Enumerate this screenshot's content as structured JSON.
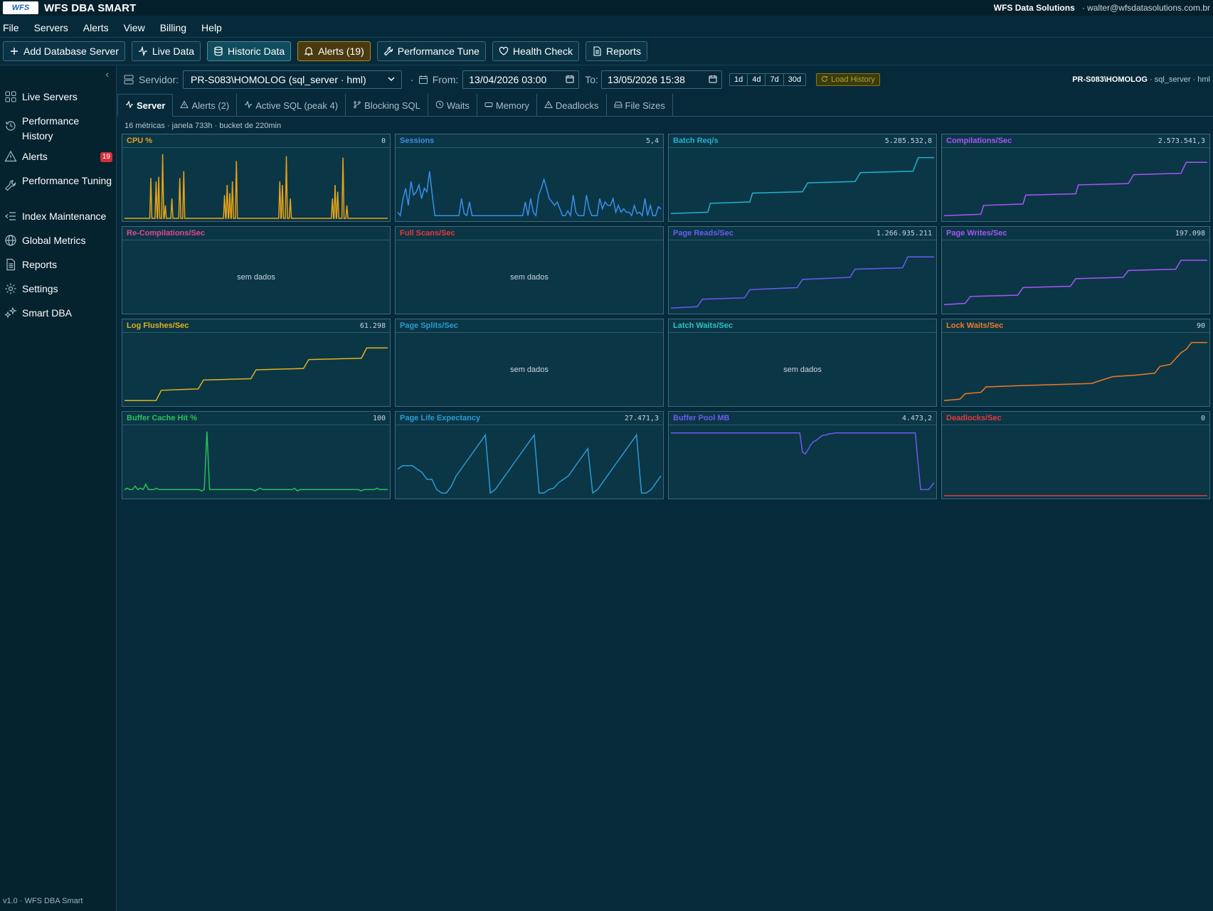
{
  "app": {
    "title": "WFS DBA SMART",
    "logo_text": "WFS",
    "company": "WFS Data Solutions",
    "user": "· walter@wfsdatasolutions.com.br"
  },
  "menu": [
    "File",
    "Servers",
    "Alerts",
    "View",
    "Billing",
    "Help"
  ],
  "toolbar": {
    "add_server": "Add Database Server",
    "live_data": "Live Data",
    "historic_data": "Historic Data",
    "alerts": "Alerts (19)",
    "performance_tune": "Performance Tune",
    "health_check": "Health Check",
    "reports": "Reports"
  },
  "sidebar": {
    "items": [
      {
        "label": "Live Servers",
        "icon": "grid-icon"
      },
      {
        "label": "Performance History",
        "icon": "history-icon"
      },
      {
        "label": "Alerts",
        "icon": "alert-triangle-icon",
        "badge": "19"
      },
      {
        "label": "Performance Tuning",
        "icon": "wrench-icon"
      },
      {
        "label": "Index Maintenance",
        "icon": "list-indent-icon"
      },
      {
        "label": "Global Metrics",
        "icon": "globe-icon"
      },
      {
        "label": "Reports",
        "icon": "document-icon"
      },
      {
        "label": "Settings",
        "icon": "gear-icon"
      },
      {
        "label": "Smart DBA",
        "icon": "sparkles-icon"
      }
    ],
    "version": "v1.0 · WFS DBA Smart"
  },
  "filter": {
    "server_label": "Servidor:",
    "server_value": "PR-S083\\HOMOLOG (sql_server · hml)",
    "dot": "·",
    "from_label": "From:",
    "from_value": "13/04/2026 03:00",
    "to_label": "To:",
    "to_value": "13/05/2026 15:38",
    "ranges": [
      "1d",
      "4d",
      "7d",
      "30d"
    ],
    "load_history": "Load History",
    "server_info_name": "PR-S083\\HOMOLOG",
    "server_info_meta": " · sql_server · hml"
  },
  "tabs": [
    "Server",
    "Alerts (2)",
    "Active SQL (peak 4)",
    "Blocking SQL",
    "Waits",
    "Memory",
    "Deadlocks",
    "File Sizes"
  ],
  "subinfo": "16 métricas · janela 733h · bucket de 220min",
  "nodata_text": "sem dados",
  "colors": {
    "orange": "#e8a317",
    "blue": "#3b8fe8",
    "cyan": "#1fb3d1",
    "purple": "#a855f7",
    "pink": "#e0488c",
    "red": "#e8383a",
    "violet": "#6a5cf0",
    "yellow": "#e2b21b",
    "sky": "#2a9bd4",
    "teal": "#2bc4c4",
    "deeporange": "#f07a25",
    "green": "#27c25a"
  },
  "metrics": [
    {
      "title": "CPU %",
      "value": "0",
      "color": "#e8a317",
      "nodata": false,
      "series": [
        0,
        0,
        0,
        0,
        0,
        0,
        0,
        0,
        0,
        0,
        0,
        0,
        0,
        0,
        0,
        0,
        0,
        0,
        0,
        0,
        0,
        0,
        0,
        0,
        0,
        0,
        0,
        0,
        0,
        0,
        0,
        0,
        0,
        0,
        0,
        0,
        0,
        0,
        0,
        0,
        0,
        0,
        0,
        0,
        0,
        0,
        0,
        0,
        0,
        0,
        0,
        0,
        0,
        0,
        0,
        0,
        0,
        0,
        0,
        0,
        0,
        0,
        0,
        0,
        0,
        0,
        0,
        0,
        0,
        0,
        0,
        0,
        0,
        0,
        0,
        0,
        0,
        0,
        0,
        0,
        0,
        0,
        0,
        0,
        0,
        0,
        0,
        0,
        0,
        0,
        0,
        0,
        0,
        0,
        0,
        0,
        0,
        0,
        0,
        0,
        0,
        0,
        0,
        0,
        0,
        0,
        0,
        0,
        0,
        0,
        0,
        0,
        0,
        0,
        0,
        0,
        0,
        0,
        0,
        0,
        0,
        0,
        0,
        0,
        0,
        0,
        0,
        0,
        0,
        0,
        0,
        0,
        0,
        0,
        0,
        0,
        0,
        0,
        0,
        0,
        0,
        0,
        0,
        0,
        0,
        0,
        0,
        0,
        0,
        0,
        0,
        0,
        0,
        0,
        0,
        0,
        0,
        0,
        0,
        0,
        0,
        0,
        0,
        0,
        0,
        0,
        0,
        0,
        0,
        0,
        0,
        0,
        0,
        0,
        0,
        0,
        0,
        0,
        0,
        0,
        0,
        0,
        0,
        0,
        0,
        0,
        0,
        0,
        0,
        0,
        0,
        0,
        0,
        0,
        0,
        0,
        0,
        0,
        0,
        0,
        0,
        0,
        0,
        0,
        0,
        0,
        0,
        0,
        0,
        0,
        0,
        0,
        0,
        0,
        0,
        0,
        0,
        0,
        0,
        0,
        0,
        0,
        0,
        0,
        0,
        0,
        0,
        0,
        0,
        0,
        0,
        0,
        0,
        0,
        0,
        0,
        0,
        0,
        0,
        0,
        0,
        0,
        0,
        0,
        0,
        0,
        0,
        0,
        0,
        0,
        0,
        0,
        0,
        0,
        0,
        0,
        0,
        0,
        0,
        0,
        0,
        0,
        0,
        0,
        0,
        0,
        0,
        0,
        0,
        0,
        0,
        0,
        0,
        0,
        0,
        0,
        0,
        0,
        0,
        0,
        0,
        0,
        0,
        0,
        0,
        0,
        0,
        0,
        0,
        0,
        0,
        0,
        0,
        0,
        0,
        0,
        0,
        0,
        0,
        0,
        0,
        0,
        0,
        0,
        0,
        0,
        0,
        0,
        0,
        0,
        0,
        0,
        0,
        0,
        0,
        0,
        0,
        0,
        0,
        0,
        0,
        0,
        0,
        0,
        0,
        0,
        0,
        0,
        0,
        0,
        0,
        0,
        0,
        0,
        0,
        0,
        0,
        0,
        0,
        0,
        0,
        0,
        0,
        0,
        0,
        0,
        0,
        0,
        0,
        0,
        0,
        0,
        0,
        0,
        0,
        0,
        0,
        0,
        0,
        0,
        0,
        0,
        0,
        0,
        0,
        0,
        0,
        0,
        0,
        0,
        0,
        0,
        0,
        0,
        0,
        0,
        0,
        0,
        0,
        0
      ],
      "spikes": [
        [
          0.1,
          0.6
        ],
        [
          0.12,
          0.55
        ],
        [
          0.13,
          0.62
        ],
        [
          0.145,
          0.95
        ],
        [
          0.155,
          0.2
        ],
        [
          0.18,
          0.3
        ],
        [
          0.21,
          0.6
        ],
        [
          0.225,
          0.7
        ],
        [
          0.38,
          0.35
        ],
        [
          0.39,
          0.5
        ],
        [
          0.4,
          0.38
        ],
        [
          0.41,
          0.55
        ],
        [
          0.425,
          0.85
        ],
        [
          0.59,
          0.55
        ],
        [
          0.6,
          0.5
        ],
        [
          0.615,
          0.92
        ],
        [
          0.63,
          0.3
        ],
        [
          0.79,
          0.3
        ],
        [
          0.8,
          0.5
        ],
        [
          0.81,
          0.4
        ],
        [
          0.83,
          0.9
        ],
        [
          0.845,
          0.2
        ]
      ]
    },
    {
      "title": "Sessions",
      "value": "5,4",
      "color": "#3b8fe8",
      "nodata": false,
      "series": [
        0.1,
        0.05,
        0.3,
        0.45,
        0.2,
        0.55,
        0.35,
        0.4,
        0.5,
        0.3,
        0.45,
        0.4,
        0.7,
        0.35,
        0.05,
        0.05,
        0.05,
        0.05,
        0.05,
        0.05,
        0.05,
        0.05,
        0.05,
        0.05,
        0.3,
        0.08,
        0.05,
        0.25,
        0.05,
        0.05,
        0.05,
        0.05,
        0.05,
        0.05,
        0.05,
        0.05,
        0.05,
        0.05,
        0.05,
        0.05,
        0.05,
        0.05,
        0.05,
        0.05,
        0.05,
        0.05,
        0.05,
        0.05,
        0.25,
        0.05,
        0.3,
        0.1,
        0.05,
        0.35,
        0.45,
        0.58,
        0.45,
        0.3,
        0.25,
        0.2,
        0.25,
        0.15,
        0.05,
        0.05,
        0.12,
        0.05,
        0.35,
        0.1,
        0.05,
        0.05,
        0.05,
        0.35,
        0.15,
        0.05,
        0.05,
        0.05,
        0.3,
        0.15,
        0.25,
        0.2,
        0.2,
        0.3,
        0.1,
        0.2,
        0.1,
        0.15,
        0.1,
        0.1,
        0.05,
        0.2,
        0.08,
        0.1,
        0.05,
        0.3,
        0.05,
        0.2,
        0.05,
        0.05,
        0.18,
        0.15
      ]
    },
    {
      "title": "Batch Req/s",
      "value": "5.285.532,8",
      "color": "#1fb3d1",
      "nodata": false,
      "steps": [
        [
          0,
          0.08
        ],
        [
          0.14,
          0.1
        ],
        [
          0.15,
          0.23
        ],
        [
          0.3,
          0.25
        ],
        [
          0.31,
          0.38
        ],
        [
          0.5,
          0.4
        ],
        [
          0.52,
          0.53
        ],
        [
          0.7,
          0.55
        ],
        [
          0.72,
          0.68
        ],
        [
          0.92,
          0.7
        ],
        [
          0.94,
          0.9
        ],
        [
          1.0,
          0.9
        ]
      ]
    },
    {
      "title": "Compilations/Sec",
      "value": "2.573.541,3",
      "color": "#a855f7",
      "nodata": false,
      "steps": [
        [
          0,
          0.05
        ],
        [
          0.14,
          0.07
        ],
        [
          0.15,
          0.2
        ],
        [
          0.3,
          0.22
        ],
        [
          0.31,
          0.35
        ],
        [
          0.5,
          0.37
        ],
        [
          0.51,
          0.5
        ],
        [
          0.7,
          0.52
        ],
        [
          0.72,
          0.65
        ],
        [
          0.9,
          0.67
        ],
        [
          0.92,
          0.83
        ],
        [
          1.0,
          0.83
        ]
      ]
    },
    {
      "title": "Re-Compilations/Sec",
      "value": "",
      "color": "#e0488c",
      "nodata": true
    },
    {
      "title": "Full Scans/Sec",
      "value": "",
      "color": "#e8383a",
      "nodata": true
    },
    {
      "title": "Page Reads/Sec",
      "value": "1.266.935.211",
      "color": "#6a5cf0",
      "nodata": false,
      "steps": [
        [
          0,
          0.05
        ],
        [
          0.1,
          0.07
        ],
        [
          0.12,
          0.18
        ],
        [
          0.28,
          0.2
        ],
        [
          0.3,
          0.32
        ],
        [
          0.48,
          0.35
        ],
        [
          0.5,
          0.47
        ],
        [
          0.68,
          0.5
        ],
        [
          0.7,
          0.62
        ],
        [
          0.88,
          0.64
        ],
        [
          0.9,
          0.8
        ],
        [
          1.0,
          0.8
        ]
      ]
    },
    {
      "title": "Page Writes/Sec",
      "value": "197.098",
      "color": "#a855f7",
      "nodata": false,
      "steps": [
        [
          0,
          0.1
        ],
        [
          0.08,
          0.12
        ],
        [
          0.1,
          0.22
        ],
        [
          0.28,
          0.24
        ],
        [
          0.3,
          0.35
        ],
        [
          0.48,
          0.37
        ],
        [
          0.5,
          0.48
        ],
        [
          0.68,
          0.5
        ],
        [
          0.7,
          0.6
        ],
        [
          0.88,
          0.62
        ],
        [
          0.9,
          0.75
        ],
        [
          1.0,
          0.75
        ]
      ]
    },
    {
      "title": "Log Flushes/Sec",
      "value": "61.298",
      "color": "#e2b21b",
      "nodata": false,
      "steps": [
        [
          0,
          0.05
        ],
        [
          0.12,
          0.05
        ],
        [
          0.14,
          0.2
        ],
        [
          0.28,
          0.22
        ],
        [
          0.3,
          0.35
        ],
        [
          0.48,
          0.37
        ],
        [
          0.5,
          0.5
        ],
        [
          0.68,
          0.52
        ],
        [
          0.7,
          0.65
        ],
        [
          0.9,
          0.67
        ],
        [
          0.92,
          0.82
        ],
        [
          1.0,
          0.82
        ]
      ]
    },
    {
      "title": "Page Splits/Sec",
      "value": "",
      "color": "#2a9bd4",
      "nodata": true
    },
    {
      "title": "Latch Waits/Sec",
      "value": "",
      "color": "#2bc4c4",
      "nodata": true
    },
    {
      "title": "Lock Waits/Sec",
      "value": "90",
      "color": "#f07a25",
      "nodata": false,
      "steps": [
        [
          0,
          0.05
        ],
        [
          0.06,
          0.07
        ],
        [
          0.08,
          0.15
        ],
        [
          0.14,
          0.17
        ],
        [
          0.16,
          0.25
        ],
        [
          0.3,
          0.27
        ],
        [
          0.56,
          0.3
        ],
        [
          0.6,
          0.35
        ],
        [
          0.64,
          0.4
        ],
        [
          0.72,
          0.42
        ],
        [
          0.8,
          0.45
        ],
        [
          0.82,
          0.55
        ],
        [
          0.86,
          0.58
        ],
        [
          0.9,
          0.75
        ],
        [
          0.92,
          0.8
        ],
        [
          0.94,
          0.9
        ],
        [
          1.0,
          0.9
        ]
      ]
    },
    {
      "title": "Buffer Cache Hit %",
      "value": "100",
      "color": "#27c25a",
      "nodata": false,
      "series": [
        0.1,
        0.12,
        0.1,
        0.1,
        0.15,
        0.1,
        0.12,
        0.1,
        0.18,
        0.1,
        0.1,
        0.1,
        0.12,
        0.1,
        0.1,
        0.1,
        0.1,
        0.1,
        0.1,
        0.1,
        0.1,
        0.1,
        0.1,
        0.1,
        0.1,
        0.1,
        0.1,
        0.1,
        0.1,
        0.08,
        0.1,
        0.95,
        0.1,
        0.1,
        0.1,
        0.1,
        0.1,
        0.1,
        0.1,
        0.1,
        0.1,
        0.1,
        0.1,
        0.1,
        0.1,
        0.1,
        0.1,
        0.1,
        0.1,
        0.08,
        0.1,
        0.12,
        0.1,
        0.1,
        0.1,
        0.1,
        0.1,
        0.1,
        0.1,
        0.1,
        0.1,
        0.1,
        0.1,
        0.1,
        0.12,
        0.08,
        0.1,
        0.1,
        0.1,
        0.1,
        0.1,
        0.1,
        0.1,
        0.1,
        0.1,
        0.1,
        0.1,
        0.1,
        0.1,
        0.1,
        0.1,
        0.1,
        0.1,
        0.1,
        0.1,
        0.1,
        0.1,
        0.1,
        0.1,
        0.08,
        0.1,
        0.1,
        0.1,
        0.1,
        0.1,
        0.12,
        0.1,
        0.1,
        0.1,
        0.1
      ]
    },
    {
      "title": "Page Life Expectancy",
      "value": "27.471,3",
      "color": "#2a9bd4",
      "nodata": false,
      "series": [
        0.4,
        0.45,
        0.45,
        0.45,
        0.4,
        0.35,
        0.25,
        0.25,
        0.1,
        0.05,
        0.05,
        0.15,
        0.3,
        0.4,
        0.5,
        0.6,
        0.7,
        0.8,
        0.9,
        0.05,
        0.1,
        0.2,
        0.3,
        0.4,
        0.5,
        0.6,
        0.7,
        0.8,
        0.9,
        0.05,
        0.05,
        0.1,
        0.12,
        0.2,
        0.25,
        0.3,
        0.4,
        0.5,
        0.6,
        0.7,
        0.05,
        0.1,
        0.2,
        0.3,
        0.4,
        0.5,
        0.6,
        0.7,
        0.8,
        0.9,
        0.05,
        0.05,
        0.1,
        0.2,
        0.3
      ]
    },
    {
      "title": "Buffer Pool MB",
      "value": "4.473,2",
      "color": "#6a5cf0",
      "nodata": false,
      "series": [
        0.93,
        0.93,
        0.93,
        0.93,
        0.93,
        0.93,
        0.93,
        0.93,
        0.93,
        0.93,
        0.93,
        0.93,
        0.93,
        0.93,
        0.93,
        0.93,
        0.93,
        0.93,
        0.93,
        0.93,
        0.93,
        0.93,
        0.93,
        0.93,
        0.93,
        0.93,
        0.93,
        0.93,
        0.93,
        0.93,
        0.93,
        0.93,
        0.93,
        0.93,
        0.93,
        0.93,
        0.93,
        0.93,
        0.93,
        0.93,
        0.93,
        0.93,
        0.93,
        0.93,
        0.93,
        0.93,
        0.93,
        0.93,
        0.93,
        0.65,
        0.62,
        0.68,
        0.75,
        0.8,
        0.82,
        0.85,
        0.88,
        0.9,
        0.9,
        0.92,
        0.92,
        0.93,
        0.93,
        0.93,
        0.93,
        0.93,
        0.93,
        0.93,
        0.93,
        0.93,
        0.93,
        0.93,
        0.93,
        0.93,
        0.93,
        0.93,
        0.93,
        0.93,
        0.93,
        0.93,
        0.93,
        0.93,
        0.93,
        0.93,
        0.93,
        0.93,
        0.93,
        0.93,
        0.93,
        0.93,
        0.93,
        0.93,
        0.5,
        0.1,
        0.1,
        0.1,
        0.1,
        0.15,
        0.2
      ]
    },
    {
      "title": "Deadlocks/Sec",
      "value": "0",
      "color": "#e8383a",
      "nodata": false,
      "series": [
        0.01,
        0.01,
        0.01,
        0.01,
        0.01,
        0.01,
        0.01,
        0.01,
        0.01,
        0.01
      ]
    }
  ]
}
